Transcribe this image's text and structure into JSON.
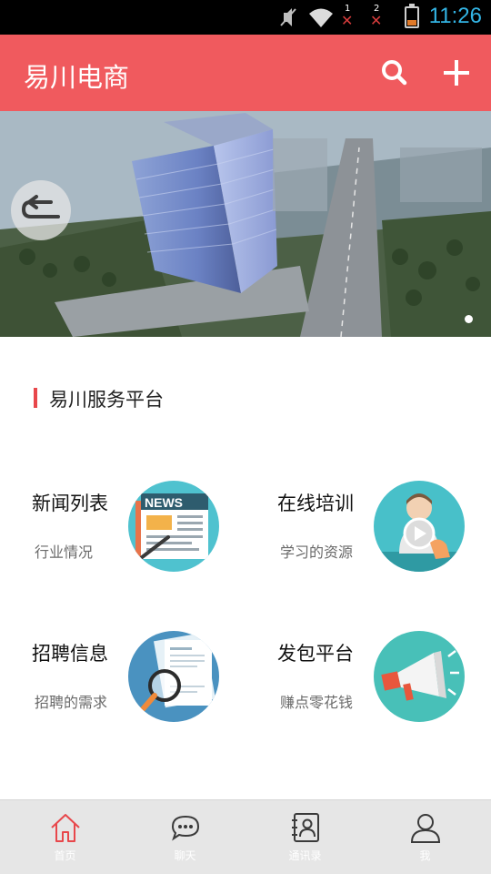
{
  "status_bar": {
    "sim1_label": "1",
    "sim2_label": "2",
    "time": "11:26",
    "icons": [
      "mute-icon",
      "wifi-icon",
      "signal-icon",
      "signal-icon",
      "battery-icon"
    ],
    "battery_level": 0.2,
    "battery_color": "#e07a2a"
  },
  "app_bar": {
    "title": "易川电商",
    "search_icon": "search-icon",
    "add_icon": "plus-icon",
    "color": "#f05a5e"
  },
  "banner": {
    "back_icon": "return-arrow-icon",
    "slide_count": 1,
    "active_slide": 1
  },
  "section": {
    "title": "易川服务平台",
    "accent": "#e8474b"
  },
  "services": [
    {
      "title": "新闻列表",
      "subtitle": "行业情况",
      "icon": "news-icon",
      "banner_text": "NEWS"
    },
    {
      "title": "在线培训",
      "subtitle": "学习的资源",
      "icon": "video-training-icon"
    },
    {
      "title": "招聘信息",
      "subtitle": "招聘的需求",
      "icon": "resume-magnifier-icon"
    },
    {
      "title": "发包平台",
      "subtitle": "赚点零花钱",
      "icon": "megaphone-icon"
    }
  ],
  "bottom_nav": {
    "items": [
      {
        "label": "首页",
        "icon": "home-icon",
        "active": true
      },
      {
        "label": "聊天",
        "icon": "chat-icon",
        "active": false
      },
      {
        "label": "通讯录",
        "icon": "contacts-icon",
        "active": false
      },
      {
        "label": "我",
        "icon": "profile-icon",
        "active": false
      }
    ],
    "active_color": "#e8474b",
    "inactive_color": "#3a3a3a"
  }
}
